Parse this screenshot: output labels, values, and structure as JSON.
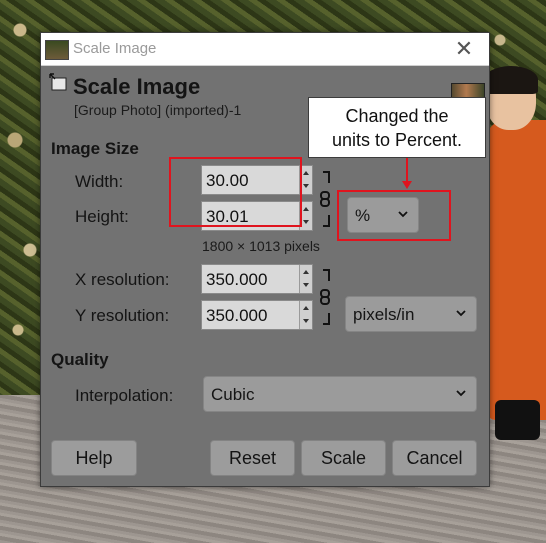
{
  "window": {
    "title": "Scale Image",
    "close_glyph": "✕"
  },
  "header": {
    "title": "Scale Image",
    "subtitle": "[Group Photo] (imported)-1"
  },
  "image_size": {
    "section_title": "Image Size",
    "width_label": "Width:",
    "width_value": "30.00",
    "height_label": "Height:",
    "height_value": "30.01",
    "pixel_dimensions": "1800 × 1013 pixels",
    "units": "%",
    "x_res_label": "X resolution:",
    "x_res_value": "350.000",
    "y_res_label": "Y resolution:",
    "y_res_value": "350.000",
    "res_units": "pixels/in"
  },
  "quality": {
    "section_title": "Quality",
    "interp_label": "Interpolation:",
    "interp_value": "Cubic"
  },
  "buttons": {
    "help": "Help",
    "reset": "Reset",
    "scale": "Scale",
    "cancel": "Cancel"
  },
  "annotation": {
    "line1": "Changed the",
    "line2": "units to Percent.",
    "color": "#e0141e"
  },
  "icons": [
    "close-icon",
    "scale-image-icon",
    "chain-link-icon",
    "chevron-down-icon",
    "spin-up-icon",
    "spin-down-icon"
  ]
}
